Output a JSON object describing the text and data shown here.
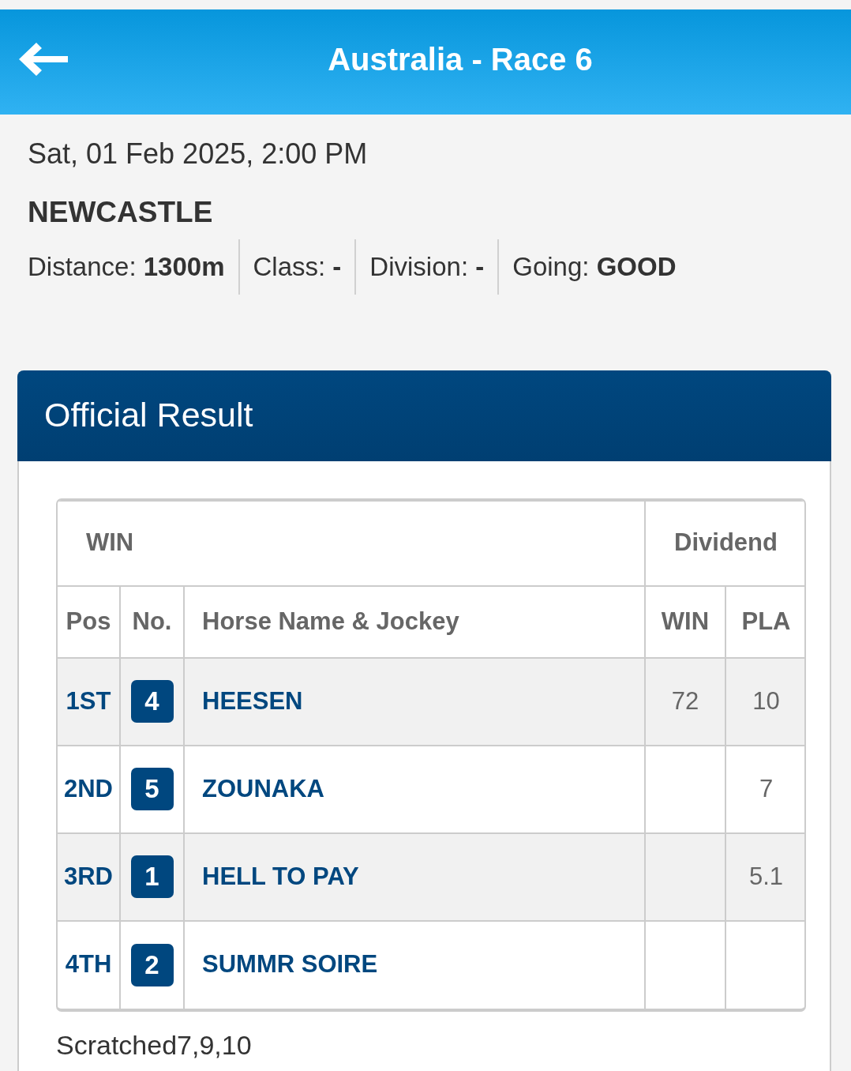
{
  "header": {
    "title": "Australia - Race 6"
  },
  "race": {
    "datetime": "Sat, 01 Feb 2025, 2:00 PM",
    "venue": "NEWCASTLE",
    "details": [
      {
        "label": "Distance:",
        "value": "1300m"
      },
      {
        "label": "Class:",
        "value": "-"
      },
      {
        "label": "Division:",
        "value": "-"
      },
      {
        "label": "Going:",
        "value": "GOOD"
      }
    ]
  },
  "result": {
    "title": "Official Result",
    "table": {
      "pool": "WIN",
      "dividend_heading": "Dividend",
      "columns": [
        "Pos",
        "No.",
        "Horse Name & Jockey",
        "WIN",
        "PLA"
      ],
      "rows": [
        {
          "pos": "1ST",
          "number": "4",
          "horse": "HEESEN",
          "win": "72",
          "pla": "10"
        },
        {
          "pos": "2ND",
          "number": "5",
          "horse": "ZOUNAKA",
          "pla": "7"
        },
        {
          "pos": "3RD",
          "number": "1",
          "horse": "HELL TO PAY",
          "pla": "5.1"
        },
        {
          "pos": "4TH",
          "number": "2",
          "horse": "SUMMR SOIRE"
        }
      ]
    },
    "scratched": "Scratched7,9,10"
  }
}
